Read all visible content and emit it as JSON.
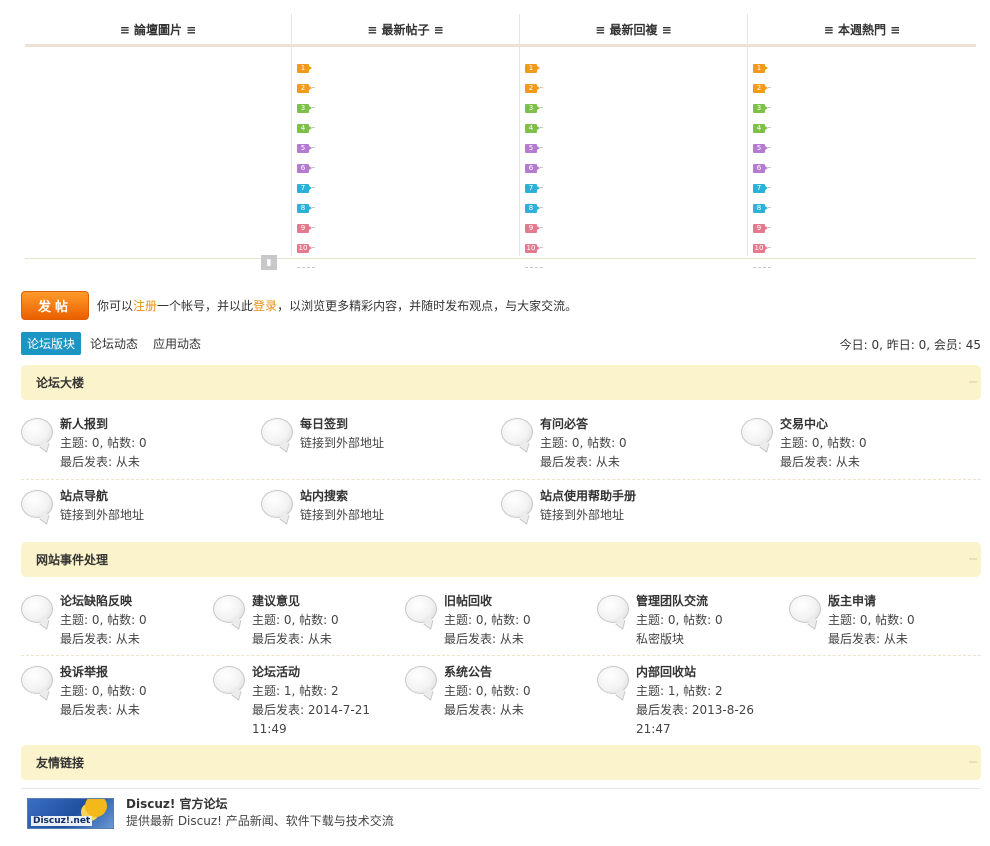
{
  "portal": {
    "tabs": [
      "≡ 論壇圖片 ≡",
      "≡ 最新帖子 ≡",
      "≡ 最新回複 ≡",
      "≡ 本週熱門 ≡"
    ],
    "rank_numbers": [
      "1",
      "2",
      "3",
      "4",
      "5",
      "6",
      "7",
      "8",
      "9",
      "10"
    ],
    "rank_colors": [
      "#f29a1c",
      "#f29a1c",
      "#7ec04a",
      "#7ec04a",
      "#b57bd1",
      "#b57bd1",
      "#2fb0d8",
      "#2fb0d8",
      "#e57a8e",
      "#e57a8e"
    ]
  },
  "post_bar": {
    "button": "发帖",
    "notice_1": "你可以",
    "register": "注册",
    "notice_2": "一个帐号，并以此",
    "login": "登录",
    "notice_3": "，以浏览更多精彩内容，并随时发布观点，与大家交流。"
  },
  "tabs": {
    "items": [
      "论坛版块",
      "论坛动态",
      "应用动态"
    ]
  },
  "stats": "今日: 0, 昨日: 0, 会员: 45",
  "sections": [
    {
      "title": "论坛大楼",
      "rows": [
        [
          {
            "name": "新人报到",
            "lines": [
              "主题: 0, 帖数: 0",
              "最后发表: 从未"
            ]
          },
          {
            "name": "每日签到",
            "lines": [
              "链接到外部地址"
            ]
          },
          {
            "name": "有问必答",
            "lines": [
              "主题: 0, 帖数: 0",
              "最后发表: 从未"
            ]
          },
          {
            "name": "交易中心",
            "lines": [
              "主题: 0, 帖数: 0",
              "最后发表: 从未"
            ]
          }
        ],
        [
          {
            "name": "站点导航",
            "lines": [
              "链接到外部地址"
            ]
          },
          {
            "name": "站内搜索",
            "lines": [
              "链接到外部地址"
            ]
          },
          {
            "name": "站点使用帮助手册",
            "lines": [
              "链接到外部地址"
            ]
          }
        ]
      ]
    },
    {
      "title": "网站事件处理",
      "rows": [
        [
          {
            "name": "论坛缺陷反映",
            "lines": [
              "主题: 0, 帖数: 0",
              "最后发表: 从未"
            ]
          },
          {
            "name": "建议意见",
            "lines": [
              "主题: 0, 帖数: 0",
              "最后发表: 从未"
            ]
          },
          {
            "name": "旧帖回收",
            "lines": [
              "主题: 0, 帖数: 0",
              "最后发表: 从未"
            ]
          },
          {
            "name": "管理团队交流",
            "lines": [
              "主题: 0, 帖数: 0",
              "私密版块"
            ]
          },
          {
            "name": "版主申请",
            "lines": [
              "主题: 0, 帖数: 0",
              "最后发表: 从未"
            ]
          }
        ],
        [
          {
            "name": "投诉举报",
            "lines": [
              "主题: 0, 帖数: 0",
              "最后发表: 从未"
            ]
          },
          {
            "name": "论坛活动",
            "lines": [
              "主题: 1, 帖数: 2",
              "最后发表: 2014-7-21",
              "11:49"
            ]
          },
          {
            "name": "系统公告",
            "lines": [
              "主题: 0, 帖数: 0",
              "最后发表: 从未"
            ]
          },
          {
            "name": "内部回收站",
            "lines": [
              "主题: 1, 帖数: 2",
              "最后发表: 2013-8-26",
              "21:47"
            ]
          }
        ]
      ]
    },
    {
      "title": "友情链接"
    }
  ],
  "links": {
    "logo_text": "Discuz!.net",
    "title": "Discuz! 官方论坛",
    "desc": "提供最新 Discuz! 产品新闻、软件下载与技术交流"
  },
  "colors": {
    "accent_blue": "#1c95c4",
    "section_bg": "#fbf3cc",
    "post_button": "#ea5f00",
    "notice_highlight": "#e89012"
  }
}
